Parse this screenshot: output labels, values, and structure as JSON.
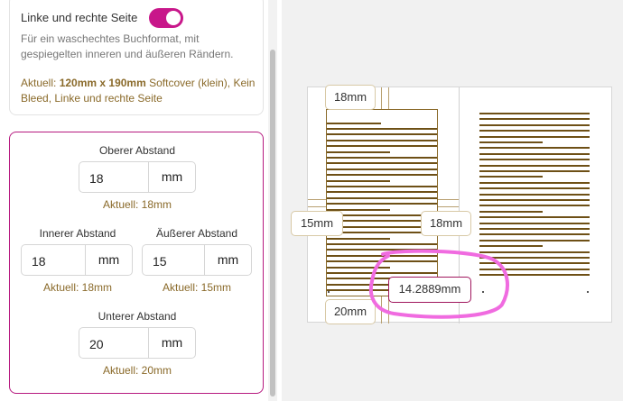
{
  "layout_card": {
    "toggle_label": "Linke und rechte Seite",
    "toggle_on": true,
    "description": "Für ein waschechtes Buchformat, mit gespiegelten inneren und äußeren Rändern.",
    "current_prefix": "Aktuell: ",
    "current_size": "120mm x 190mm",
    "current_suffix": " Softcover (klein), Kein Bleed, Linke und rechte Seite"
  },
  "margins": {
    "top": {
      "label": "Oberer Abstand",
      "value": "18",
      "unit": "mm",
      "current": "Aktuell: 18mm"
    },
    "inner": {
      "label": "Innerer Abstand",
      "value": "18",
      "unit": "mm",
      "current": "Aktuell: 18mm"
    },
    "outer": {
      "label": "Äußerer Abstand",
      "value": "15",
      "unit": "mm",
      "current": "Aktuell: 15mm"
    },
    "bottom": {
      "label": "Unterer Abstand",
      "value": "20",
      "unit": "mm",
      "current": "Aktuell: 20mm"
    }
  },
  "preview": {
    "top_margin_label": "18mm",
    "left_margin_label": "15mm",
    "inner_margin_label": "18mm",
    "bottom_margin_label": "20mm",
    "measurement_label": "14.2889mm"
  },
  "colors": {
    "accent": "#c8178a",
    "gold": "#8a6a2a",
    "text_lines": "#6e5016",
    "annotation": "#f06be0"
  }
}
